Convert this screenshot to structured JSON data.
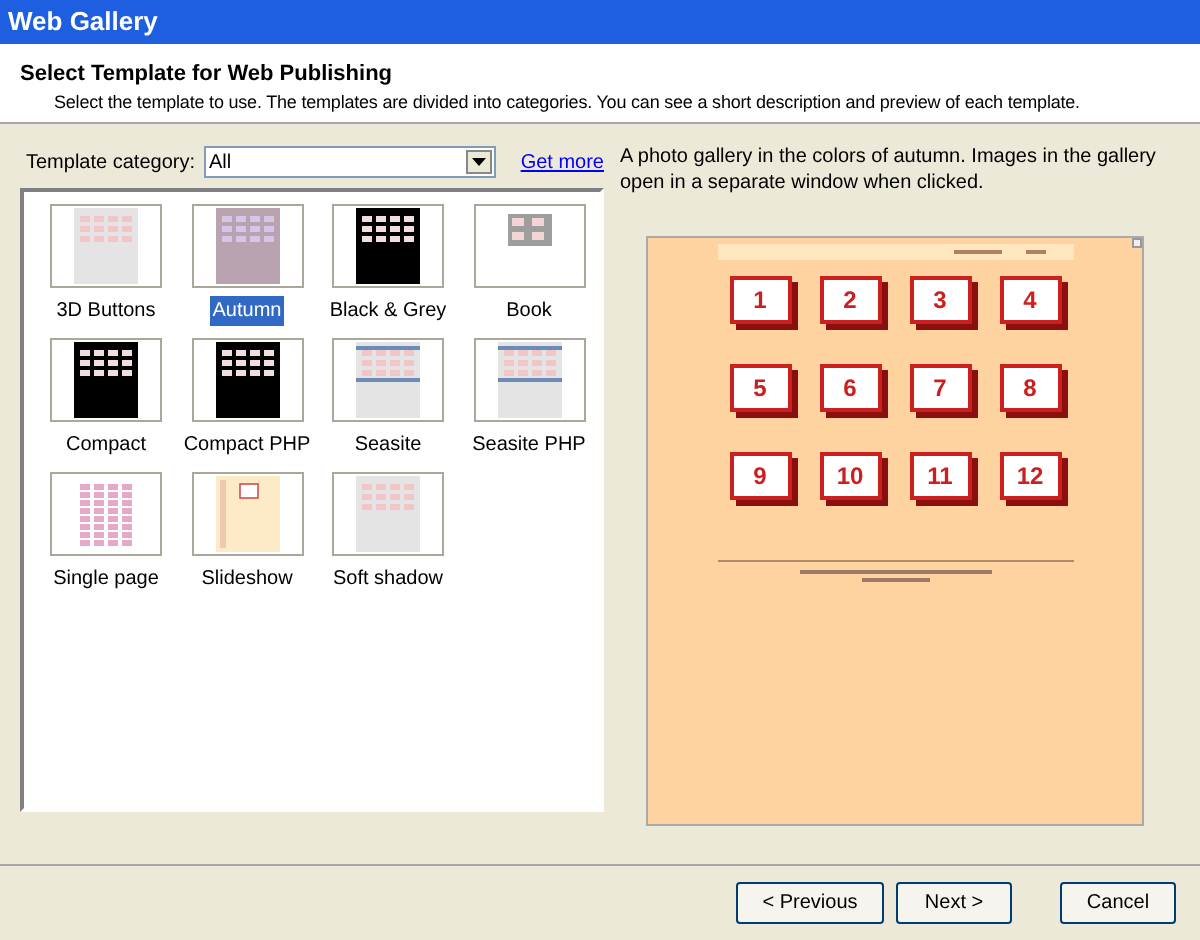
{
  "window": {
    "title": "Web Gallery"
  },
  "header": {
    "title": "Select Template for Web Publishing",
    "description": "Select the template to use. The templates are divided into categories. You can see a short description and preview of each template."
  },
  "category": {
    "label": "Template category:",
    "value": "All",
    "link": "Get more"
  },
  "templates": [
    {
      "label": "3D Buttons",
      "selected": false,
      "kind": "light"
    },
    {
      "label": "Autumn",
      "selected": true,
      "kind": "mauve"
    },
    {
      "label": "Black & Grey",
      "selected": false,
      "kind": "dark"
    },
    {
      "label": "Book",
      "selected": false,
      "kind": "book"
    },
    {
      "label": "Compact",
      "selected": false,
      "kind": "dark"
    },
    {
      "label": "Compact PHP",
      "selected": false,
      "kind": "dark"
    },
    {
      "label": "Seasite",
      "selected": false,
      "kind": "seaside"
    },
    {
      "label": "Seasite PHP",
      "selected": false,
      "kind": "seaside"
    },
    {
      "label": "Single page",
      "selected": false,
      "kind": "pink"
    },
    {
      "label": "Slideshow",
      "selected": false,
      "kind": "slideshow"
    },
    {
      "label": "Soft shadow",
      "selected": false,
      "kind": "light"
    }
  ],
  "template_description": "A photo gallery in the colors of autumn. Images in the gallery open in a separate window when clicked.",
  "preview": {
    "tiles": [
      "1",
      "2",
      "3",
      "4",
      "5",
      "6",
      "7",
      "8",
      "9",
      "10",
      "11",
      "12"
    ]
  },
  "buttons": [
    "< Previous",
    "Next >",
    "Cancel"
  ]
}
